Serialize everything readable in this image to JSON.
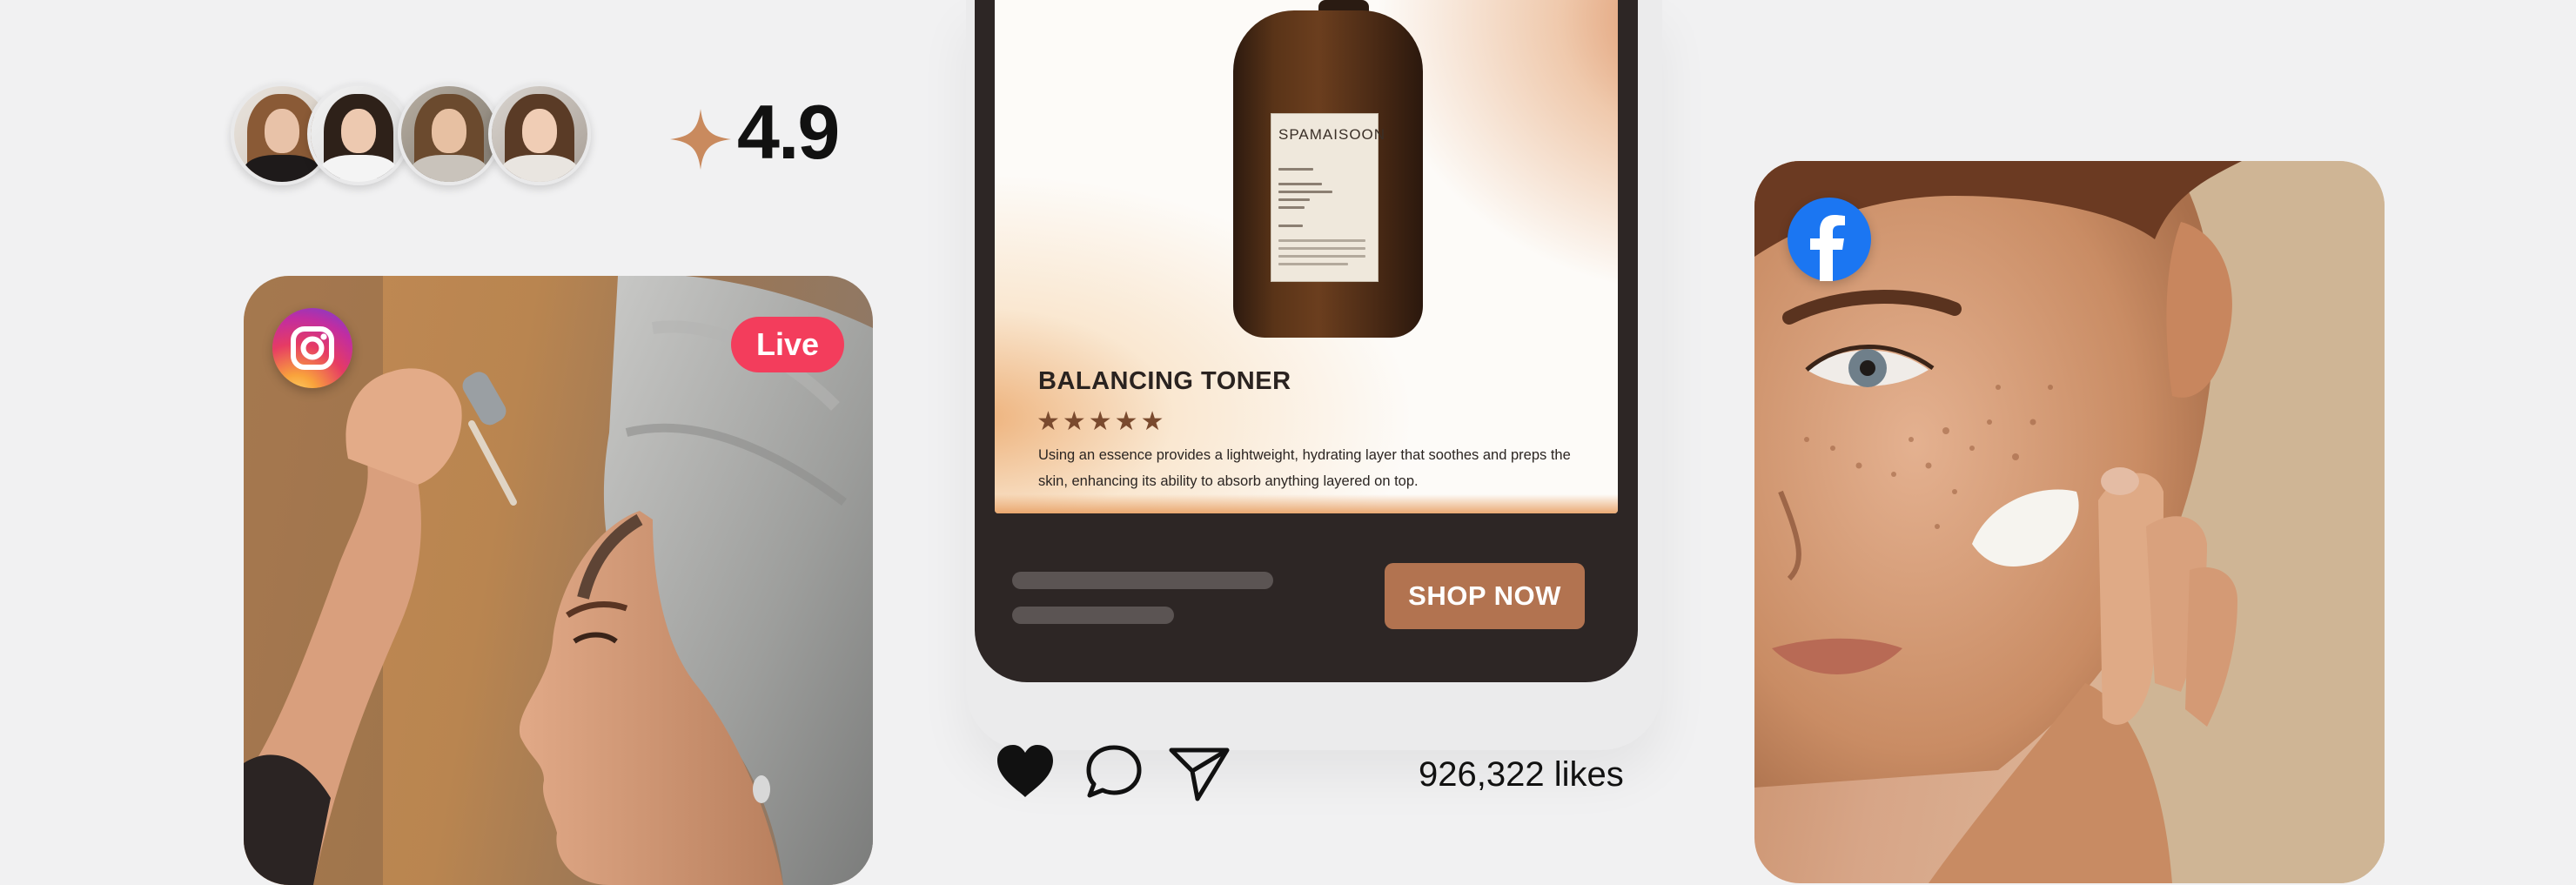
{
  "rating": {
    "value": "4.9"
  },
  "live_post": {
    "badge": "Live"
  },
  "product": {
    "brand": "SPAMAISOON",
    "title": "BALANCING TONER",
    "stars": "★★★★★",
    "description": "Using an essence provides a lightweight, hydrating layer that soothes and preps the skin, enhancing its ability to absorb anything layered on top.",
    "cta": "SHOP NOW"
  },
  "post": {
    "likes": "926,322 likes"
  },
  "colors": {
    "background": "#f1f1f2",
    "phone": "#2d2625",
    "accent": "#b27350",
    "live": "#f33d5c",
    "facebook": "#1b76f2"
  },
  "icons": [
    "four-point-star-icon",
    "instagram-icon",
    "facebook-icon",
    "heart-icon",
    "comment-icon",
    "share-icon"
  ]
}
